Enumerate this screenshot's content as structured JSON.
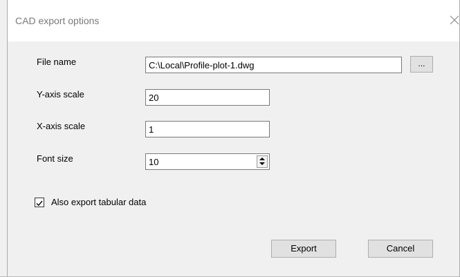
{
  "dialog": {
    "title": "CAD export options"
  },
  "fields": {
    "file_name": {
      "label": "File name",
      "value": "C:\\Local\\Profile-plot-1.dwg",
      "browse_label": "..."
    },
    "y_axis_scale": {
      "label": "Y-axis scale",
      "value": "20"
    },
    "x_axis_scale": {
      "label": "X-axis scale",
      "value": "1"
    },
    "font_size": {
      "label": "Font size",
      "value": "10"
    }
  },
  "options": {
    "export_tabular": {
      "label": "Also export tabular data",
      "checked": true
    }
  },
  "buttons": {
    "export_label": "Export",
    "cancel_label": "Cancel"
  },
  "icons": {
    "close": "close-icon",
    "check": "checkmark-icon",
    "spin_up": "arrow-up-icon",
    "spin_down": "arrow-down-icon"
  }
}
